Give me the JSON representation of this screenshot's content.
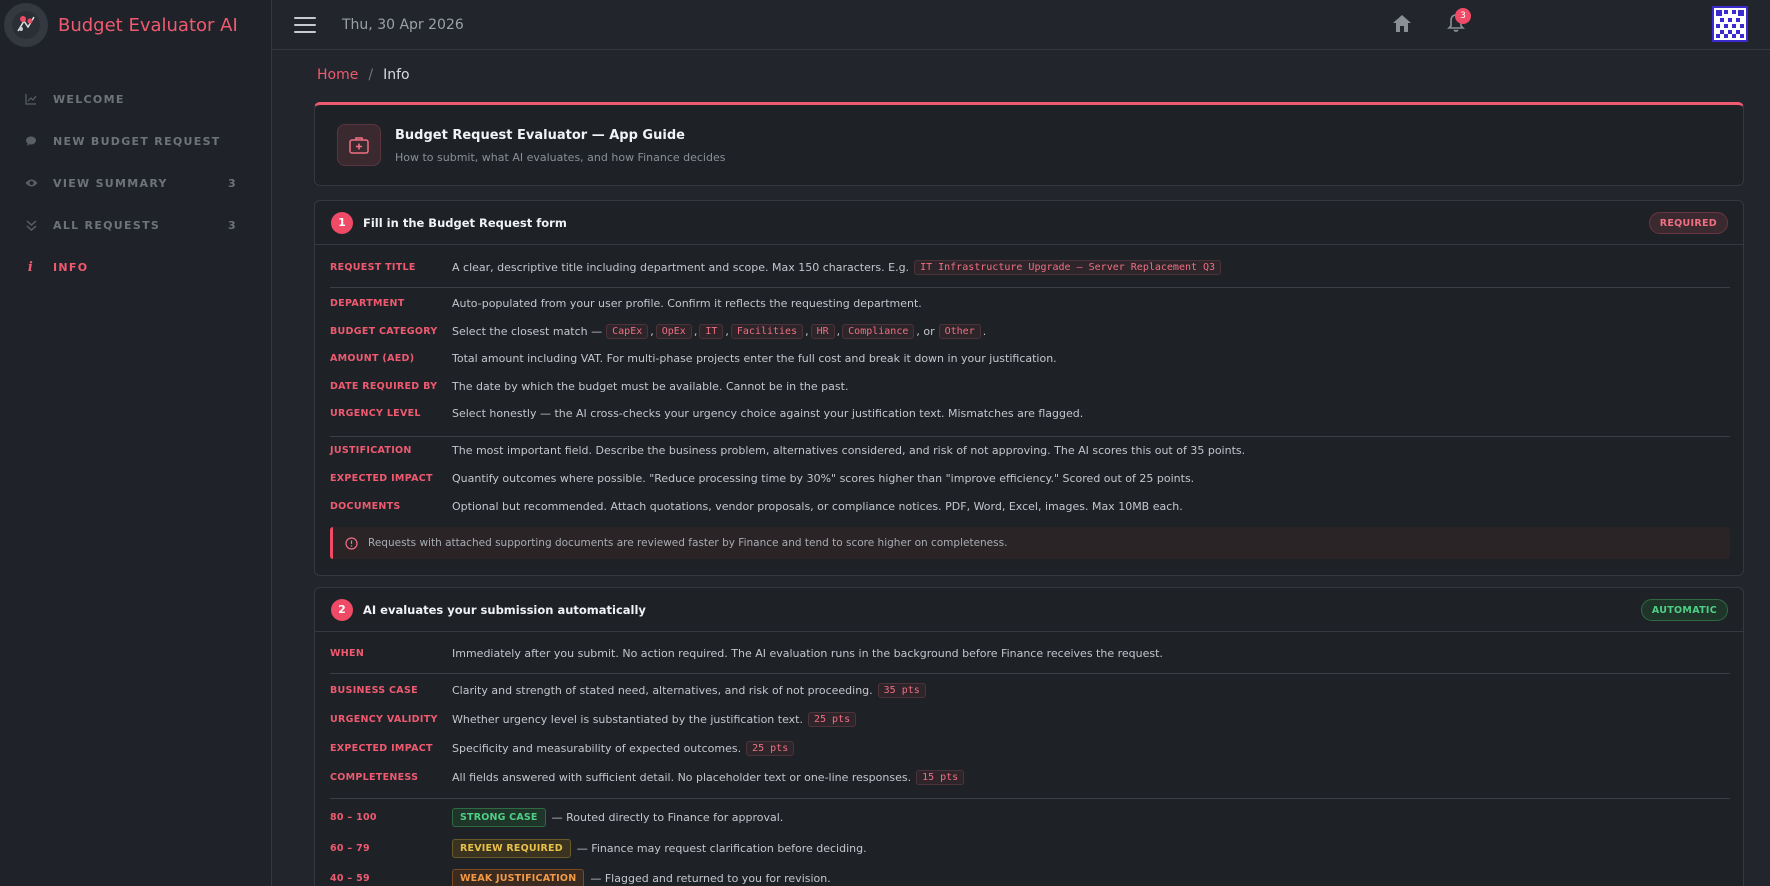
{
  "app": {
    "title": "Budget Evaluator AI"
  },
  "sidebar": {
    "items": [
      {
        "label": "WELCOME",
        "icon": "chart-line-icon",
        "count": ""
      },
      {
        "label": "NEW BUDGET REQUEST",
        "icon": "comment-icon",
        "count": ""
      },
      {
        "label": "VIEW SUMMARY",
        "icon": "eye-icon",
        "count": "3"
      },
      {
        "label": "ALL REQUESTS",
        "icon": "double-chevron-down-icon",
        "count": "3"
      },
      {
        "label": "INFO",
        "icon": "info-icon",
        "count": "",
        "active": true
      }
    ]
  },
  "header": {
    "date": "Thu, 30 Apr 2026",
    "notification_count": "3"
  },
  "breadcrumb": {
    "home": "Home",
    "separator": "/",
    "current": "Info"
  },
  "guide": {
    "title": "Budget Request Evaluator — App Guide",
    "subtitle": "How to submit, what AI evaluates, and how Finance decides"
  },
  "step1": {
    "number": "1",
    "title": "Fill in the Budget Request form",
    "badge": "REQUIRED",
    "fields": {
      "title": {
        "label": "REQUEST TITLE",
        "text": "A clear, descriptive title including department and scope. Max 150 characters. E.g.",
        "example": "IT Infrastructure Upgrade — Server Replacement Q3"
      },
      "department": {
        "label": "DEPARTMENT",
        "text": "Auto-populated from your user profile. Confirm it reflects the requesting department."
      },
      "category": {
        "label": "BUDGET CATEGORY",
        "text": "Select the closest match —",
        "options": [
          "CapEx",
          "OpEx",
          "IT",
          "Facilities",
          "HR",
          "Compliance",
          "Other"
        ],
        "or": ", or",
        "comma": ",",
        "end": "."
      },
      "amount": {
        "label": "AMOUNT (AED)",
        "text": "Total amount including VAT. For multi-phase projects enter the full cost and break it down in your justification."
      },
      "date": {
        "label": "DATE REQUIRED BY",
        "text": "The date by which the budget must be available. Cannot be in the past."
      },
      "urgency": {
        "label": "URGENCY LEVEL",
        "text": "Select honestly — the AI cross-checks your urgency choice against your justification text. Mismatches are flagged."
      },
      "justification": {
        "label": "JUSTIFICATION",
        "text": "The most important field. Describe the business problem, alternatives considered, and risk of not approving. The AI scores this out of 35 points."
      },
      "impact": {
        "label": "EXPECTED IMPACT",
        "text": "Quantify outcomes where possible. \"Reduce processing time by 30%\" scores higher than \"improve efficiency.\" Scored out of 25 points."
      },
      "documents": {
        "label": "DOCUMENTS",
        "text": "Optional but recommended. Attach quotations, vendor proposals, or compliance notices. PDF, Word, Excel, images. Max 10MB each."
      }
    },
    "note": "Requests with attached supporting documents are reviewed faster by Finance and tend to score higher on completeness."
  },
  "step2": {
    "number": "2",
    "title": "AI evaluates your submission automatically",
    "badge": "AUTOMATIC",
    "when": {
      "label": "WHEN",
      "text": "Immediately after you submit. No action required. The AI evaluation runs in the background before Finance receives the request."
    },
    "criteria": [
      {
        "label": "BUSINESS CASE",
        "text": "Clarity and strength of stated need, alternatives, and risk of not proceeding.",
        "points": "35 pts"
      },
      {
        "label": "URGENCY VALIDITY",
        "text": "Whether urgency level is substantiated by the justification text.",
        "points": "25 pts"
      },
      {
        "label": "EXPECTED IMPACT",
        "text": "Specificity and measurability of expected outcomes.",
        "points": "25 pts"
      },
      {
        "label": "COMPLETENESS",
        "text": "All fields answered with sufficient detail. No placeholder text or one-line responses.",
        "points": "15 pts"
      }
    ],
    "bands": [
      {
        "range": "80 – 100",
        "tag": "STRONG CASE",
        "text": "— Routed directly to Finance for approval.",
        "color": "#4fcf86"
      },
      {
        "range": "60 – 79",
        "tag": "REVIEW REQUIRED",
        "text": "— Finance may request clarification before deciding.",
        "color": "#e7c14a"
      },
      {
        "range": "40 – 59",
        "tag": "WEAK JUSTIFICATION",
        "text": "— Flagged and returned to you for revision.",
        "color": "#f29a45"
      }
    ]
  }
}
